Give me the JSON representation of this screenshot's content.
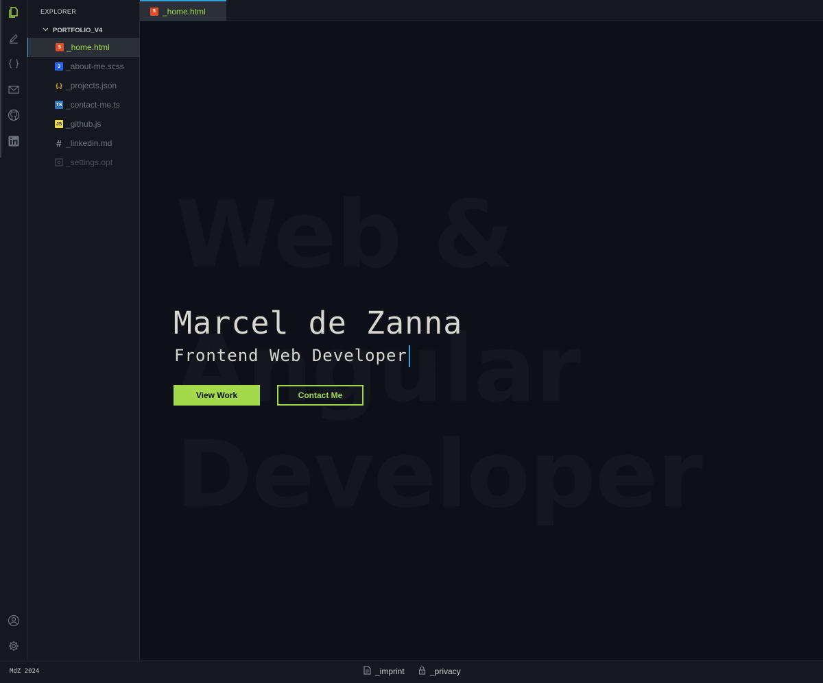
{
  "explorer": {
    "title": "EXPLORER",
    "folder": "PORTFOLIO_V4",
    "files": [
      {
        "name": "_home.html",
        "icon": "html5-icon"
      },
      {
        "name": "_about-me.scss",
        "icon": "css3-icon"
      },
      {
        "name": "_projects.json",
        "icon": "json-icon"
      },
      {
        "name": "_contact-me.ts",
        "icon": "typescript-icon"
      },
      {
        "name": "_github.js",
        "icon": "javascript-icon"
      },
      {
        "name": "_linkedin.md",
        "icon": "hash-icon"
      },
      {
        "name": "_settings.opt",
        "icon": "settings-file-icon"
      }
    ]
  },
  "tab": {
    "label": "_home.html"
  },
  "hero": {
    "name": "Marcel de Zanna",
    "role": "Frontend Web Developer",
    "background_words": [
      "Web &",
      "Angular",
      "Developer"
    ],
    "primary_button": "View Work",
    "secondary_button": "Contact Me"
  },
  "status": {
    "left": "MdZ 2024",
    "imprint": "_imprint",
    "privacy": "_privacy"
  },
  "colors": {
    "accent": "#a3d94a",
    "background": "#0d1017",
    "panel": "#15191f",
    "highlight": "#3aa0d9"
  }
}
